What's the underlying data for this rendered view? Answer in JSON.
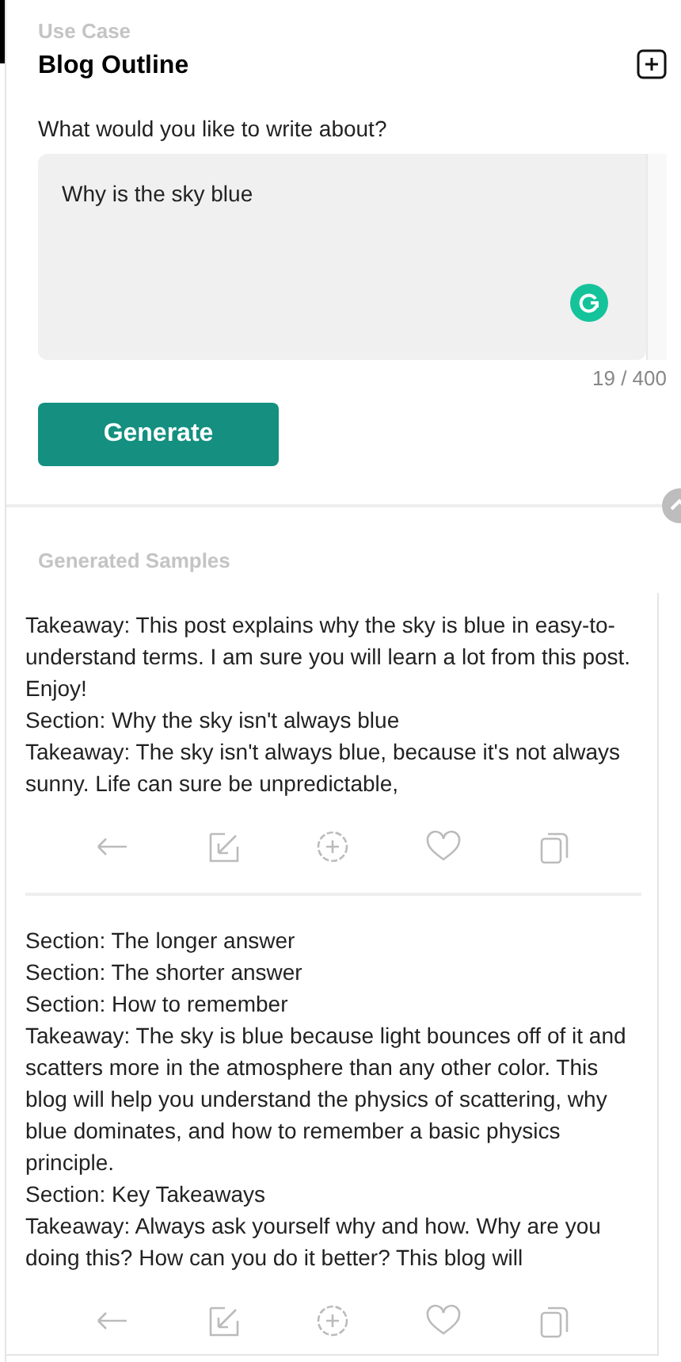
{
  "use_case": {
    "label": "Use Case",
    "title": "Blog Outline"
  },
  "prompt": {
    "label": "What would you like to write about?",
    "value": "Why is the sky blue",
    "count": "19 / 400"
  },
  "generate_button": "Generate",
  "samples_heading": "Generated Samples",
  "samples": [
    {
      "lines": [
        "Takeaway: This post explains why the sky is blue in easy-to-understand terms. I am sure you will learn a lot from this post. Enjoy!",
        "Section: Why the sky isn't always blue",
        "Takeaway: The sky isn't always blue, because it's not always sunny. Life can sure be unpredictable,"
      ]
    },
    {
      "lines": [
        "Section: The longer answer",
        "Section: The shorter answer",
        "Section: How to remember",
        "Takeaway: The sky is blue because light bounces off of it and scatters more in the atmosphere than any other color. This blog will help you understand the physics of scattering, why blue dominates, and how to remember a basic physics principle.",
        "Section: Key Takeaways",
        "Takeaway: Always ask yourself why and how. Why are you doing this? How can you do it better? This blog will"
      ]
    }
  ]
}
